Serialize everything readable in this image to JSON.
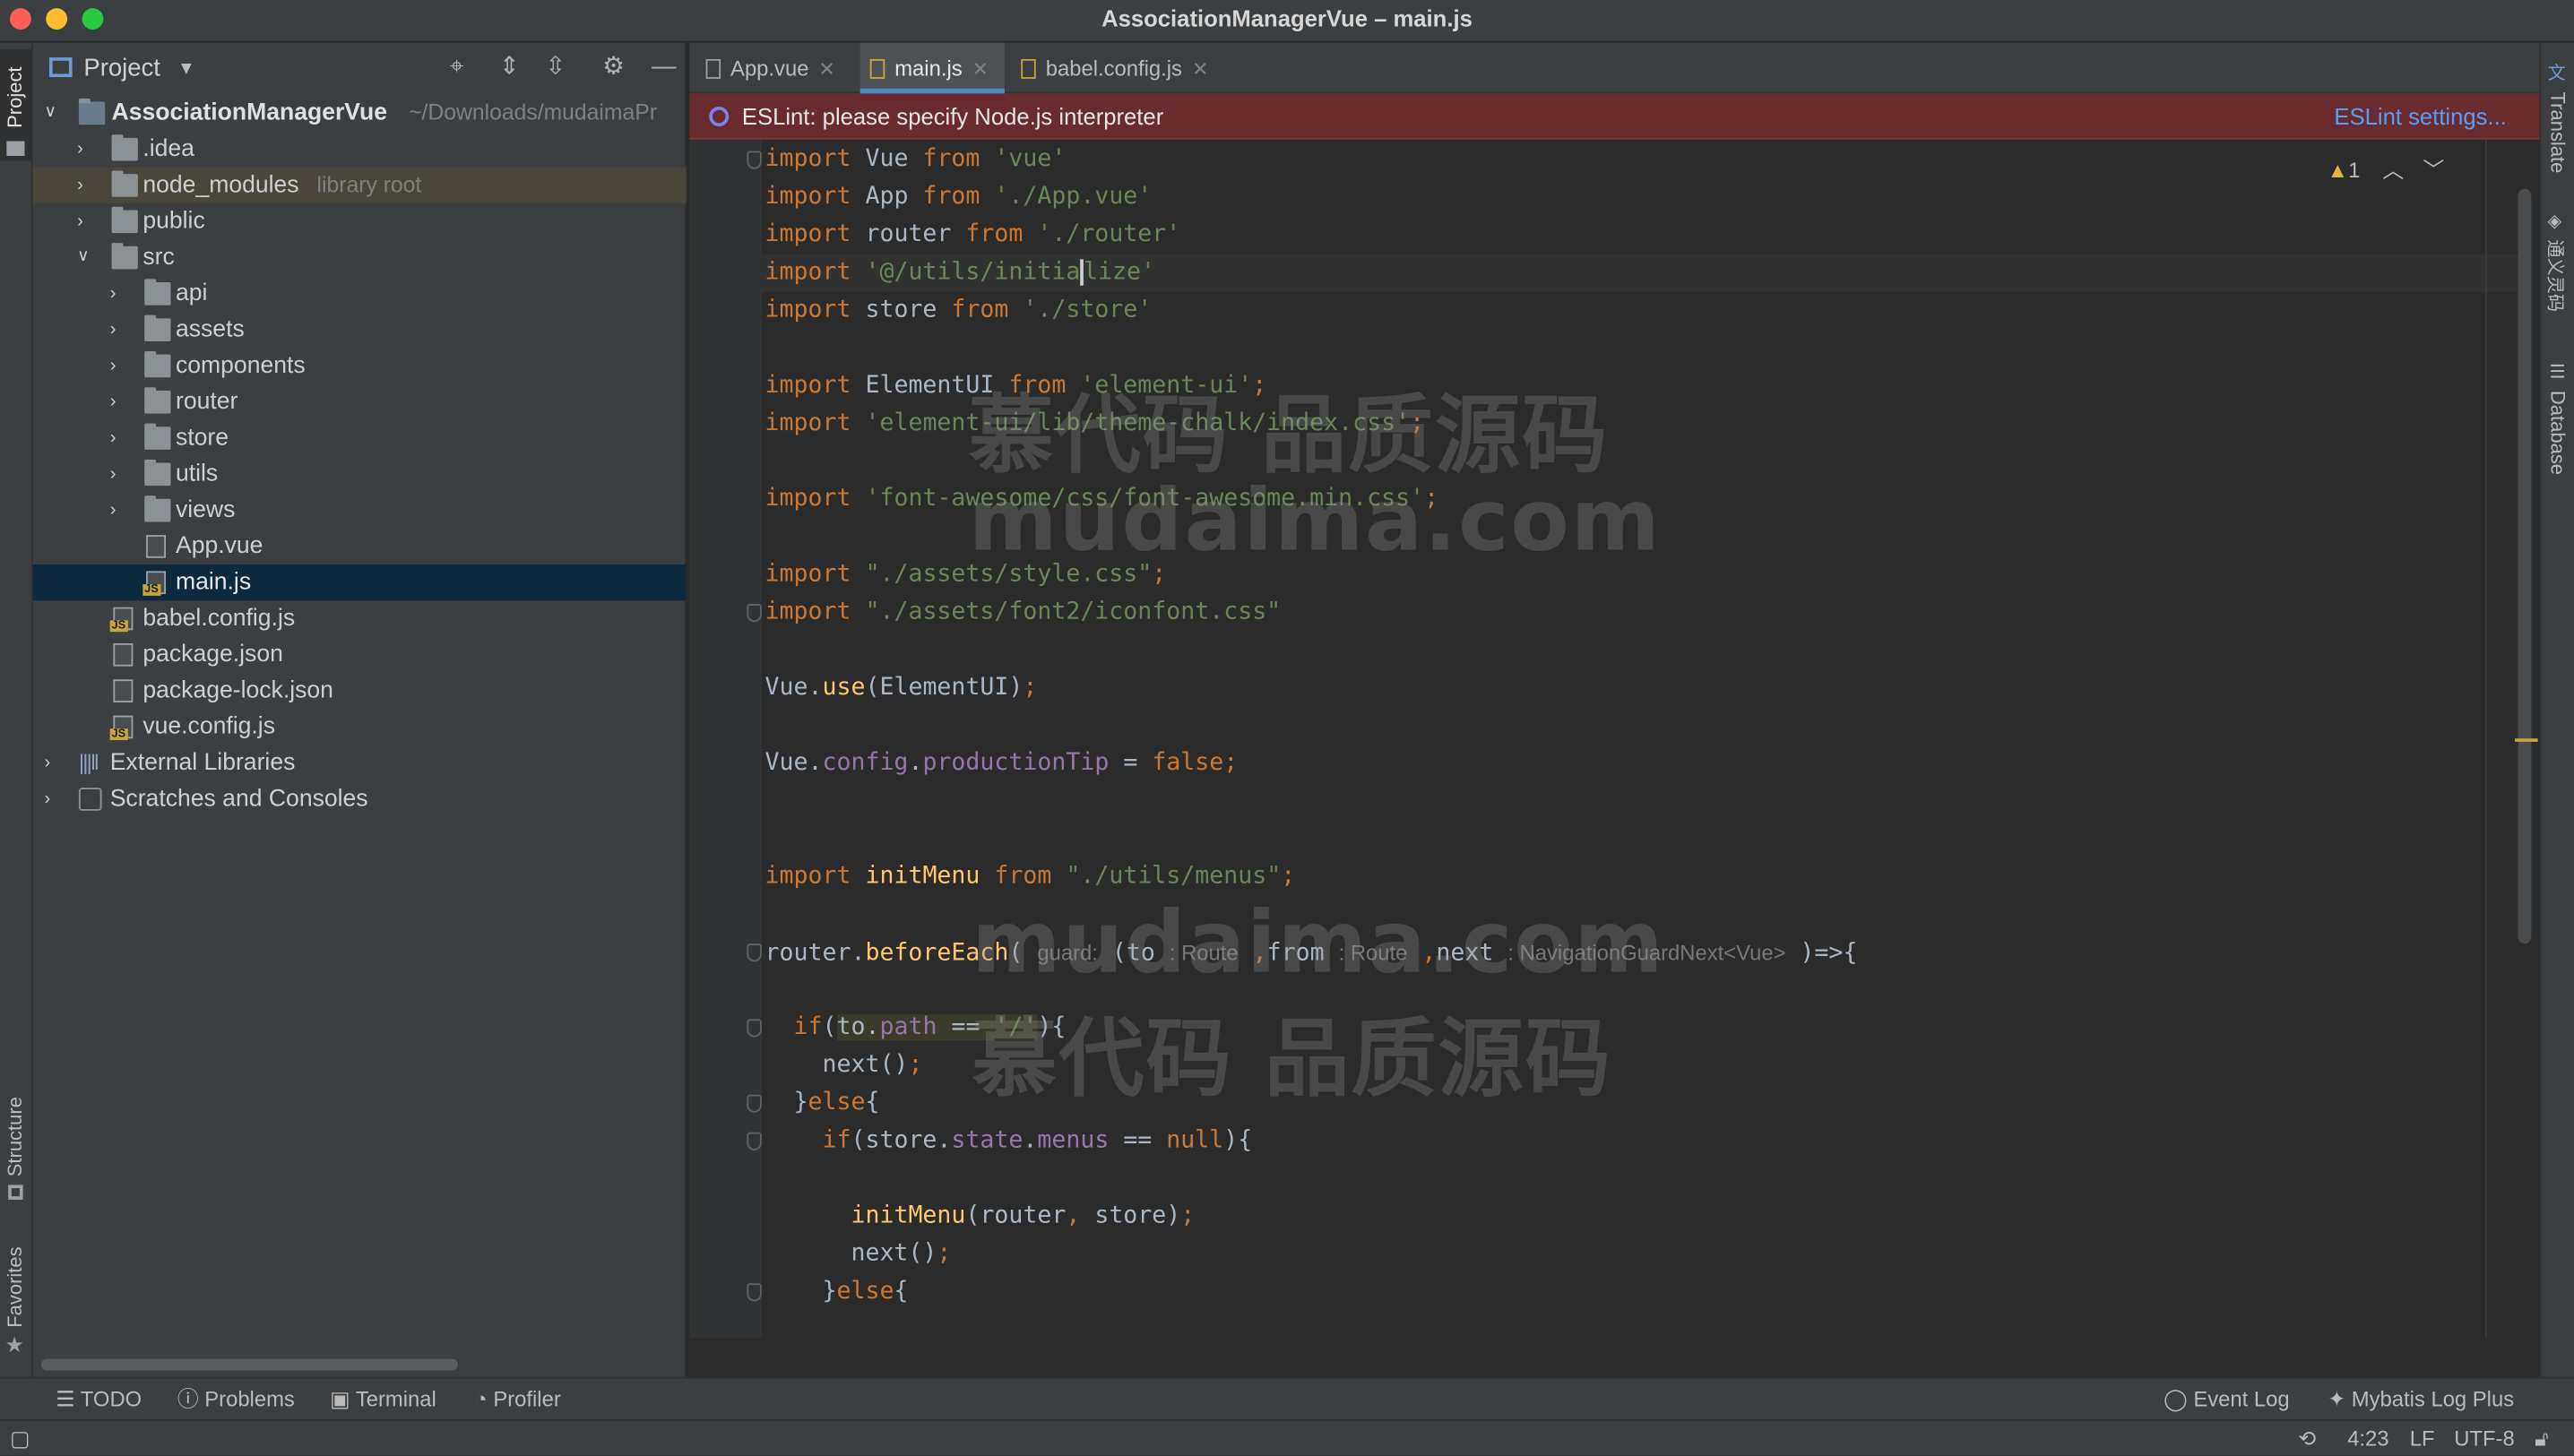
{
  "window": {
    "title": "AssociationManagerVue – main.js"
  },
  "traffic_colors": {
    "close": "#ff5f57",
    "minimize": "#febc2e",
    "maximize": "#28c840"
  },
  "left_strip": {
    "project": "Project",
    "structure": "Structure",
    "favorites": "Favorites"
  },
  "right_strip": {
    "translate": "Translate",
    "tongyi": "通义灵码",
    "database": "Database"
  },
  "project_panel": {
    "title": "Project",
    "tree": [
      {
        "label": "AssociationManagerVue",
        "hint": "~/Downloads/mudaimaPr",
        "type": "module",
        "expanded": true
      },
      {
        "label": ".idea",
        "type": "folder"
      },
      {
        "label": "node_modules",
        "hint": "library root",
        "type": "folder"
      },
      {
        "label": "public",
        "type": "folder"
      },
      {
        "label": "src",
        "type": "folder",
        "expanded": true
      },
      {
        "label": "api",
        "type": "folder"
      },
      {
        "label": "assets",
        "type": "folder"
      },
      {
        "label": "components",
        "type": "folder"
      },
      {
        "label": "router",
        "type": "folder"
      },
      {
        "label": "store",
        "type": "folder"
      },
      {
        "label": "utils",
        "type": "folder"
      },
      {
        "label": "views",
        "type": "folder"
      },
      {
        "label": "App.vue",
        "type": "file"
      },
      {
        "label": "main.js",
        "type": "js",
        "selected": true
      },
      {
        "label": "babel.config.js",
        "type": "js"
      },
      {
        "label": "package.json",
        "type": "json"
      },
      {
        "label": "package-lock.json",
        "type": "json"
      },
      {
        "label": "vue.config.js",
        "type": "js"
      },
      {
        "label": "External Libraries",
        "type": "lib"
      },
      {
        "label": "Scratches and Consoles",
        "type": "scratch"
      }
    ]
  },
  "tabs": [
    {
      "label": "App.vue"
    },
    {
      "label": "main.js",
      "active": true
    },
    {
      "label": "babel.config.js"
    }
  ],
  "eslint": {
    "message": "ESLint: please specify Node.js interpreter",
    "link": "ESLint settings..."
  },
  "editor": {
    "warnings": "1",
    "inlay": {
      "guard": "guard:",
      "to": ": Route",
      "from": ": Route",
      "next": ": NavigationGuardNext<Vue>"
    },
    "watermarks": [
      "慕代码 品质源码",
      "mudaima.com",
      "mudaima.com",
      "慕代码 品质源码"
    ]
  },
  "bottom_tools": {
    "todo": "TODO",
    "problems": "Problems",
    "terminal": "Terminal",
    "profiler": "Profiler",
    "event_log": "Event Log",
    "mybatis": "Mybatis Log Plus"
  },
  "status": {
    "position": "4:23",
    "line_ending": "LF",
    "encoding": "UTF-8"
  }
}
